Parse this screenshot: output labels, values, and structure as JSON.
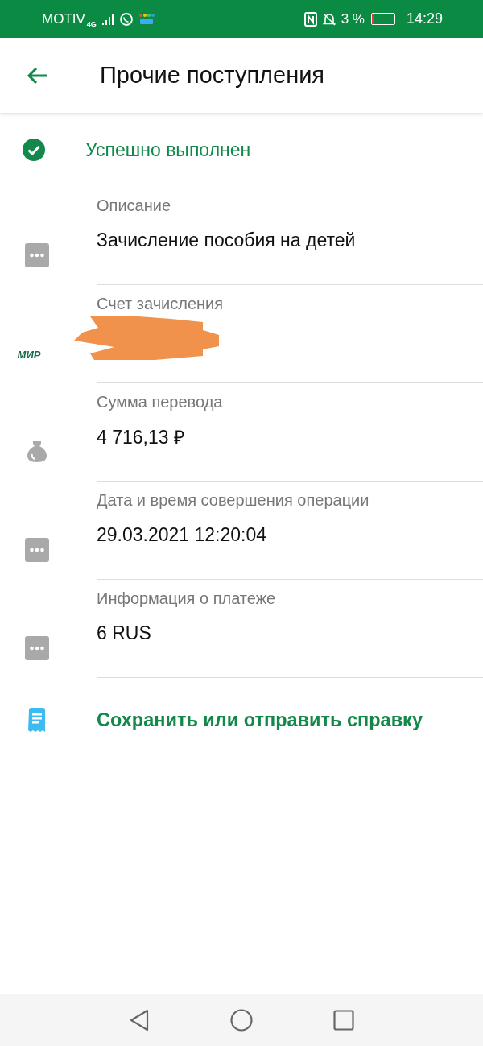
{
  "status_bar": {
    "carrier": "MOTIV",
    "network": "4G",
    "battery": "3 %",
    "time": "14:29"
  },
  "header": {
    "title": "Прочие поступления"
  },
  "status": {
    "text": "Успешно выполнен"
  },
  "details": [
    {
      "kind": "dots",
      "label": "Описание",
      "value": "Зачисление пособия на детей"
    },
    {
      "kind": "mir",
      "label": "Счет зачисления",
      "logo": "МИР",
      "redacted": true
    },
    {
      "kind": "bag",
      "label": "Сумма перевода",
      "value": "4 716,13 ₽"
    },
    {
      "kind": "dots",
      "label": "Дата и время совершения операции",
      "value": "29.03.2021 12:20:04"
    },
    {
      "kind": "dots",
      "label": "Информация о платеже",
      "value": "6 RUS"
    }
  ],
  "action": {
    "label": "Сохранить или отправить справку"
  }
}
